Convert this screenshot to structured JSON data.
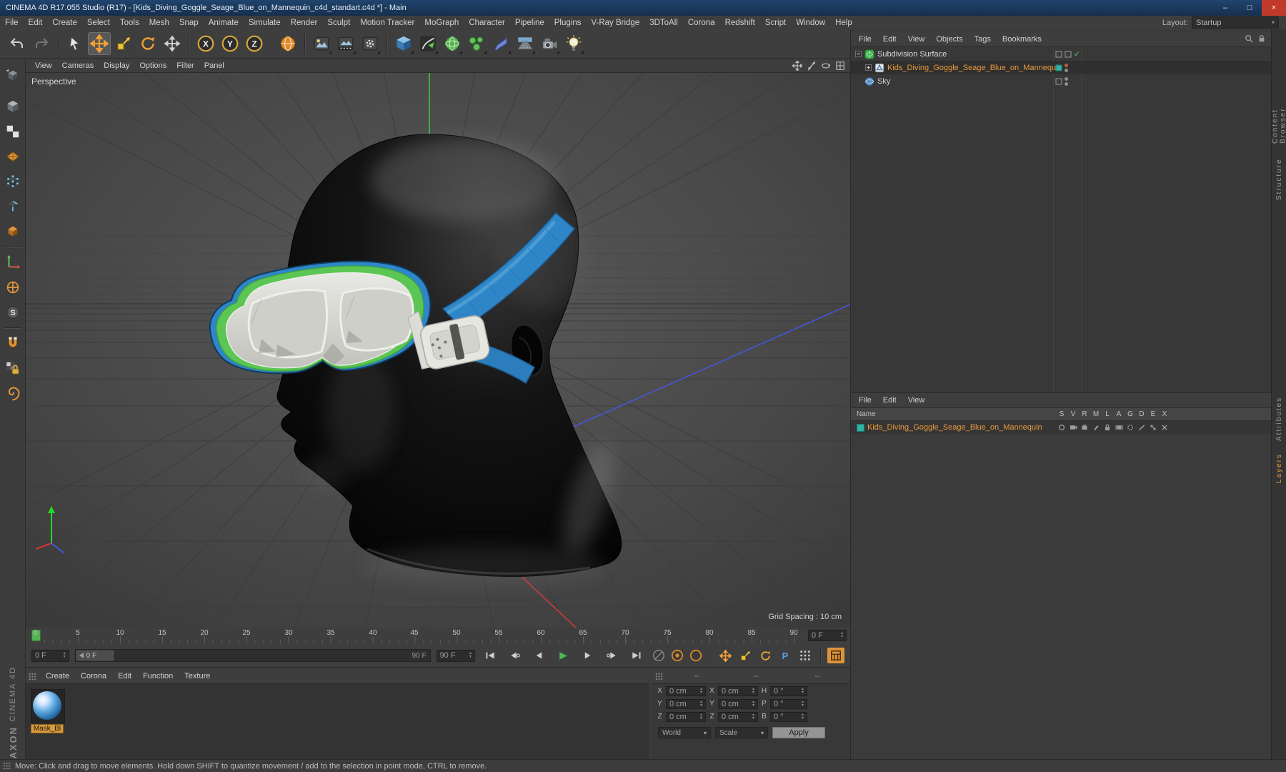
{
  "window": {
    "title": "CINEMA 4D R17.055 Studio (R17) - [Kids_Diving_Goggle_Seage_Blue_on_Mannequin_c4d_standart.c4d *] - Main",
    "minimize": "–",
    "maximize": "□",
    "close": "×"
  },
  "menu_bar": {
    "items": [
      "File",
      "Edit",
      "Create",
      "Select",
      "Tools",
      "Mesh",
      "Snap",
      "Animate",
      "Simulate",
      "Render",
      "Sculpt",
      "Motion Tracker",
      "MoGraph",
      "Character",
      "Pipeline",
      "Plugins",
      "V-Ray Bridge",
      "3DToAll",
      "Corona",
      "Redshift",
      "Script",
      "Window",
      "Help"
    ],
    "layout_label": "Layout:",
    "layout_value": "Startup"
  },
  "toolbar": {
    "axis_x": "X",
    "axis_y": "Y",
    "axis_z": "Z"
  },
  "left_toolbar": {
    "snap_letter": "S"
  },
  "viewport": {
    "menu": [
      "View",
      "Cameras",
      "Display",
      "Options",
      "Filter",
      "Panel"
    ],
    "label": "Perspective",
    "grid_spacing": "Grid Spacing : 10 cm"
  },
  "object_manager": {
    "menu": [
      "File",
      "Edit",
      "View",
      "Objects",
      "Tags",
      "Bookmarks"
    ],
    "items": [
      "Subdivision Surface",
      "Kids_Diving_Goggle_Seage_Blue_on_Mannequin",
      "Sky"
    ]
  },
  "layer_manager": {
    "menu": [
      "File",
      "Edit",
      "View"
    ],
    "name_header": "Name",
    "columns": [
      "S",
      "V",
      "R",
      "M",
      "L",
      "A",
      "G",
      "D",
      "E",
      "X"
    ],
    "row_label": "Kids_Diving_Goggle_Seage_Blue_on_Mannequin",
    "layer_color": "#2fb3a6"
  },
  "timeline": {
    "ticks": [
      "0",
      "5",
      "10",
      "15",
      "20",
      "25",
      "30",
      "35",
      "40",
      "45",
      "50",
      "55",
      "60",
      "65",
      "70",
      "75",
      "80",
      "85",
      "90"
    ],
    "ruler_spinner": "0 F",
    "current_frame": "0 F",
    "handle_label": "0 F",
    "range_end": "90 F",
    "end_spinner": "90 F",
    "parameter_letter": "P"
  },
  "material_manager": {
    "menu": [
      "Create",
      "Corona",
      "Edit",
      "Function",
      "Texture"
    ],
    "material_label": "Mask_Bl"
  },
  "coordinates": {
    "headers": [
      "--",
      "--",
      "--"
    ],
    "col1": {
      "labels": [
        "X",
        "Y",
        "Z"
      ],
      "values": [
        "0 cm",
        "0 cm",
        "0 cm"
      ]
    },
    "col2": {
      "labels": [
        "X",
        "Y",
        "Z"
      ],
      "values": [
        "0 cm",
        "0 cm",
        "0 cm"
      ]
    },
    "col3": {
      "labels": [
        "H",
        "P",
        "B"
      ],
      "values": [
        "0 °",
        "0 °",
        "0 °"
      ]
    },
    "world": "World",
    "scale": "Scale",
    "apply": "Apply"
  },
  "status_bar": {
    "text": "Move: Click and drag to move elements. Hold down SHIFT to quantize movement / add to the selection in point mode, CTRL to remove."
  },
  "side_tabs": {
    "items": [
      "Content Browser",
      "Structure",
      "Attributes",
      "Layers"
    ]
  },
  "branding": {
    "line1": "MAXON",
    "line2": "CINEMA 4D"
  },
  "icons": {
    "spinner_up": "▴",
    "spinner_down": "▾",
    "dropdown_arrow": "▾",
    "check_mark": "✓"
  },
  "colors": {
    "accent_orange": "#e89a3c",
    "strap_blue": "#2e86c8",
    "gasket_green": "#5bc653",
    "layer_teal": "#2fb3a6"
  }
}
